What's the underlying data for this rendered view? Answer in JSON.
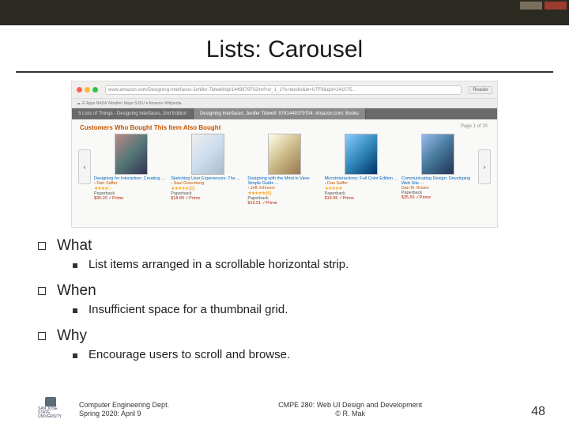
{
  "slide": {
    "title": "Lists: Carousel",
    "pagenum": "48"
  },
  "figure": {
    "window_title": "Designing Interfaces: Jennifer Tidwell: 9781449379704: Amazon.com: Books",
    "url": "www.amazon.com/Designing-Interfaces-Jenifer-Tidwell/dp/1449379702/ref=sr_1_1?s=books&ie=UTF8&qid=141075...",
    "reader_label": "Reader",
    "bookmarks": "☁  ☰  Apps  NASA  Weather  Maps  SJSU ▾  Amazon  Wikipedia",
    "tab1": "5 Lists of Things - Designing Interfaces, 2nd Edition",
    "tab2": "Designing Interfaces: Jenifer Tidwell: 9781449379704: Amazon.com: Books",
    "heading": "Customers Who Bought This Item Also Bought",
    "pages": "Page 1 of 20",
    "nav_prev": "‹",
    "nav_next": "›",
    "items": [
      {
        "name": "Designing for Interaction: Creating ...",
        "auth": "› Dan Saffer",
        "stars": "★★★★☆",
        "fmt": "Paperback",
        "price": "$35.20 ✓Prime"
      },
      {
        "name": "Sketching User Experiences: The ...",
        "auth": "› Saul Greenberg",
        "stars": "★★★★★ (15)",
        "fmt": "Paperback",
        "price": "$18.80 ✓Prime"
      },
      {
        "name": "Designing with the Mind in View: Simple Guide ...",
        "auth": "› Jeff Johnson",
        "stars": "★★★★★ (62)",
        "fmt": "Paperback",
        "price": "$19.51 ✓Prime"
      },
      {
        "name": "Microinteractions: Full Color Edition ...",
        "auth": "› Dan Saffer",
        "stars": "★★★★★",
        "fmt": "Paperback",
        "price": "$19.95 ✓Prime"
      },
      {
        "name": "Communicating Design: Developing Web Site ...",
        "auth": "Dan M. Brown",
        "stars": "",
        "fmt": "Paperback",
        "price": "$35.55 ✓Prime"
      }
    ]
  },
  "bullets": {
    "what": {
      "h": "What",
      "t": "List items arranged in a scrollable horizontal strip."
    },
    "when": {
      "h": "When",
      "t": "Insufficient space for a thumbnail grid."
    },
    "why": {
      "h": "Why",
      "t": "Encourage users to scroll and browse."
    }
  },
  "footer": {
    "dept": "Computer Engineering Dept.",
    "term": "Spring 2020: April 9",
    "course": "CMPE 280: Web UI Design and Development",
    "cr": "© R. Mak",
    "univ": "SAN JOSE STATE UNIVERSITY"
  }
}
